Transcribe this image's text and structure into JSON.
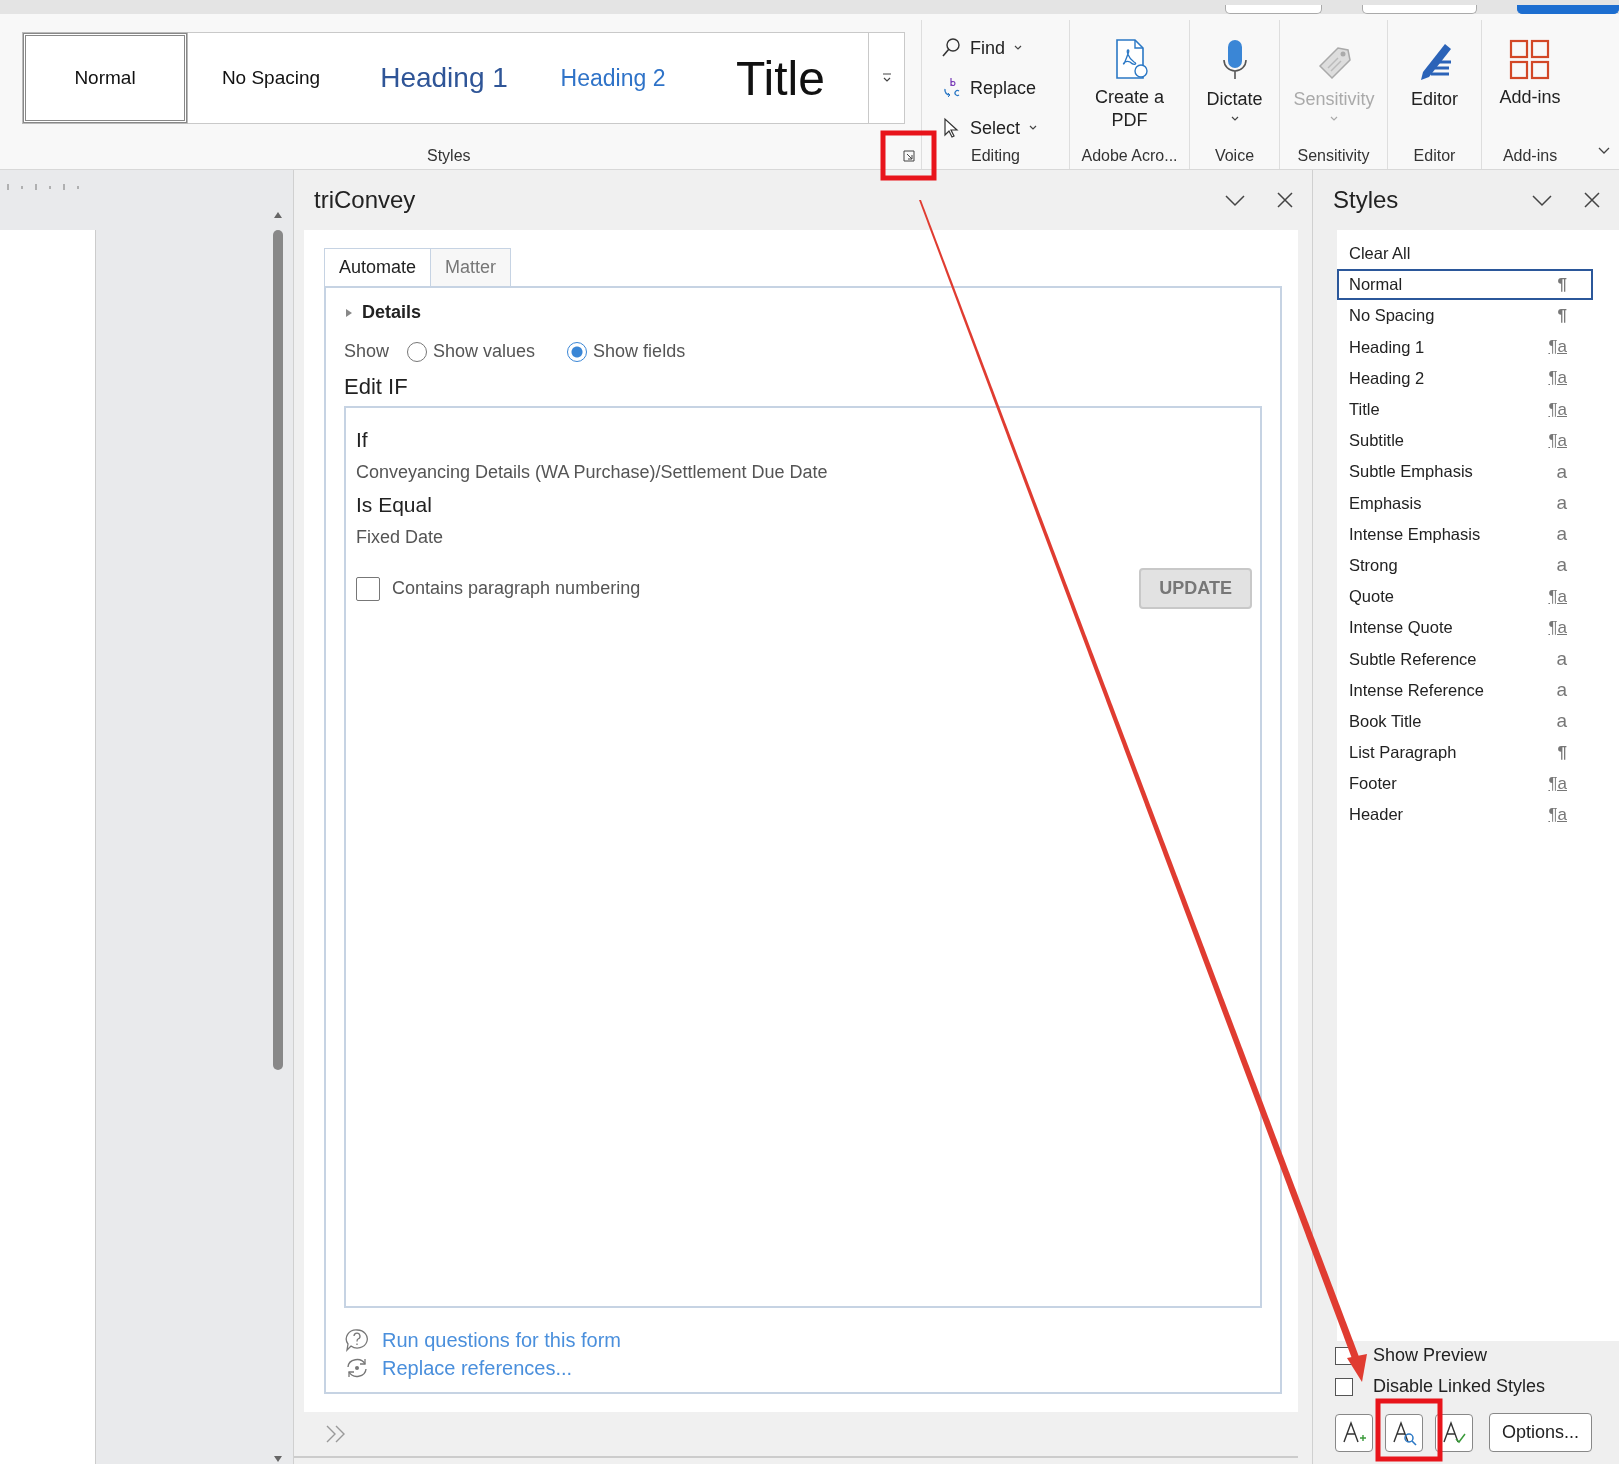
{
  "ribbon": {
    "gallery": [
      {
        "label": "Normal",
        "kind": "normal",
        "selected": true
      },
      {
        "label": "No Spacing",
        "kind": "nospacing",
        "selected": false
      },
      {
        "label": "Heading 1",
        "kind": "heading1",
        "selected": false
      },
      {
        "label": "Heading 2",
        "kind": "heading2",
        "selected": false
      },
      {
        "label": "Title",
        "kind": "title",
        "selected": false
      }
    ],
    "styles_label": "Styles",
    "editing": {
      "label": "Editing",
      "items": [
        {
          "label": "Find",
          "kind": "find",
          "dropdown": true
        },
        {
          "label": "Replace",
          "kind": "replace",
          "dropdown": false
        },
        {
          "label": "Select",
          "kind": "select",
          "dropdown": true
        }
      ]
    },
    "groups": [
      {
        "label": "Adobe Acro...",
        "button": "Create a PDF",
        "kind": "pdf",
        "dropdown": false,
        "disabled": false
      },
      {
        "label": "Voice",
        "button": "Dictate",
        "kind": "mic",
        "dropdown": true,
        "disabled": false
      },
      {
        "label": "Sensitivity",
        "button": "Sensitivity",
        "kind": "sensitivity",
        "dropdown": true,
        "disabled": true
      },
      {
        "label": "Editor",
        "button": "Editor",
        "kind": "editor",
        "dropdown": false,
        "disabled": false
      },
      {
        "label": "Add-ins",
        "button": "Add-ins",
        "kind": "addins",
        "dropdown": false,
        "disabled": false
      }
    ]
  },
  "task_pane": {
    "title": "triConvey",
    "tabs": [
      {
        "label": "Automate",
        "selected": true
      },
      {
        "label": "Matter",
        "selected": false
      }
    ],
    "section": {
      "label": "Details",
      "expanded": false
    },
    "show_label": "Show",
    "show_options": [
      {
        "label": "Show values",
        "selected": false
      },
      {
        "label": "Show fields",
        "selected": true
      }
    ],
    "heading": "Edit IF",
    "condition": [
      {
        "kind": "label",
        "text": "If"
      },
      {
        "kind": "value",
        "text": "Conveyancing Details (WA Purchase)/Settlement Due Date"
      },
      {
        "kind": "label",
        "text": "Is Equal"
      },
      {
        "kind": "value",
        "text": "Fixed Date"
      }
    ],
    "checkbox": {
      "label": "Contains paragraph numbering",
      "checked": false
    },
    "update_button": "UPDATE",
    "links": [
      {
        "label": "Run questions for this form",
        "kind": "question"
      },
      {
        "label": "Replace references...",
        "kind": "refresh"
      }
    ]
  },
  "styles_pane": {
    "title": "Styles",
    "items": [
      {
        "name": "Clear All",
        "selected": false
      },
      {
        "name": "Normal",
        "kind": "paragraph",
        "symbol": "¶",
        "selected": true
      },
      {
        "name": "No Spacing",
        "kind": "paragraph",
        "symbol": "¶",
        "selected": false
      },
      {
        "name": "Heading 1",
        "kind": "linked",
        "symbol": "¶a",
        "selected": false
      },
      {
        "name": "Heading 2",
        "kind": "linked",
        "symbol": "¶a",
        "selected": false
      },
      {
        "name": "Title",
        "kind": "linked",
        "symbol": "¶a",
        "selected": false
      },
      {
        "name": "Subtitle",
        "kind": "linked",
        "symbol": "¶a",
        "selected": false
      },
      {
        "name": "Subtle Emphasis",
        "kind": "character",
        "symbol": "a",
        "selected": false
      },
      {
        "name": "Emphasis",
        "kind": "character",
        "symbol": "a",
        "selected": false
      },
      {
        "name": "Intense Emphasis",
        "kind": "character",
        "symbol": "a",
        "selected": false
      },
      {
        "name": "Strong",
        "kind": "character",
        "symbol": "a",
        "selected": false
      },
      {
        "name": "Quote",
        "kind": "linked",
        "symbol": "¶a",
        "selected": false
      },
      {
        "name": "Intense Quote",
        "kind": "linked",
        "symbol": "¶a",
        "selected": false
      },
      {
        "name": "Subtle Reference",
        "kind": "character",
        "symbol": "a",
        "selected": false
      },
      {
        "name": "Intense Reference",
        "kind": "character",
        "symbol": "a",
        "selected": false
      },
      {
        "name": "Book Title",
        "kind": "character",
        "symbol": "a",
        "selected": false
      },
      {
        "name": "List Paragraph",
        "kind": "paragraph",
        "symbol": "¶",
        "selected": false
      },
      {
        "name": "Footer",
        "kind": "linked",
        "symbol": "¶a",
        "selected": false
      },
      {
        "name": "Header",
        "kind": "linked",
        "symbol": "¶a",
        "selected": false
      }
    ],
    "options": [
      {
        "label": "Show Preview",
        "checked": false
      },
      {
        "label": "Disable Linked Styles",
        "checked": false
      }
    ],
    "tools": [
      {
        "kind": "new"
      },
      {
        "kind": "inspect"
      },
      {
        "kind": "manage"
      }
    ],
    "options_button": "Options..."
  }
}
